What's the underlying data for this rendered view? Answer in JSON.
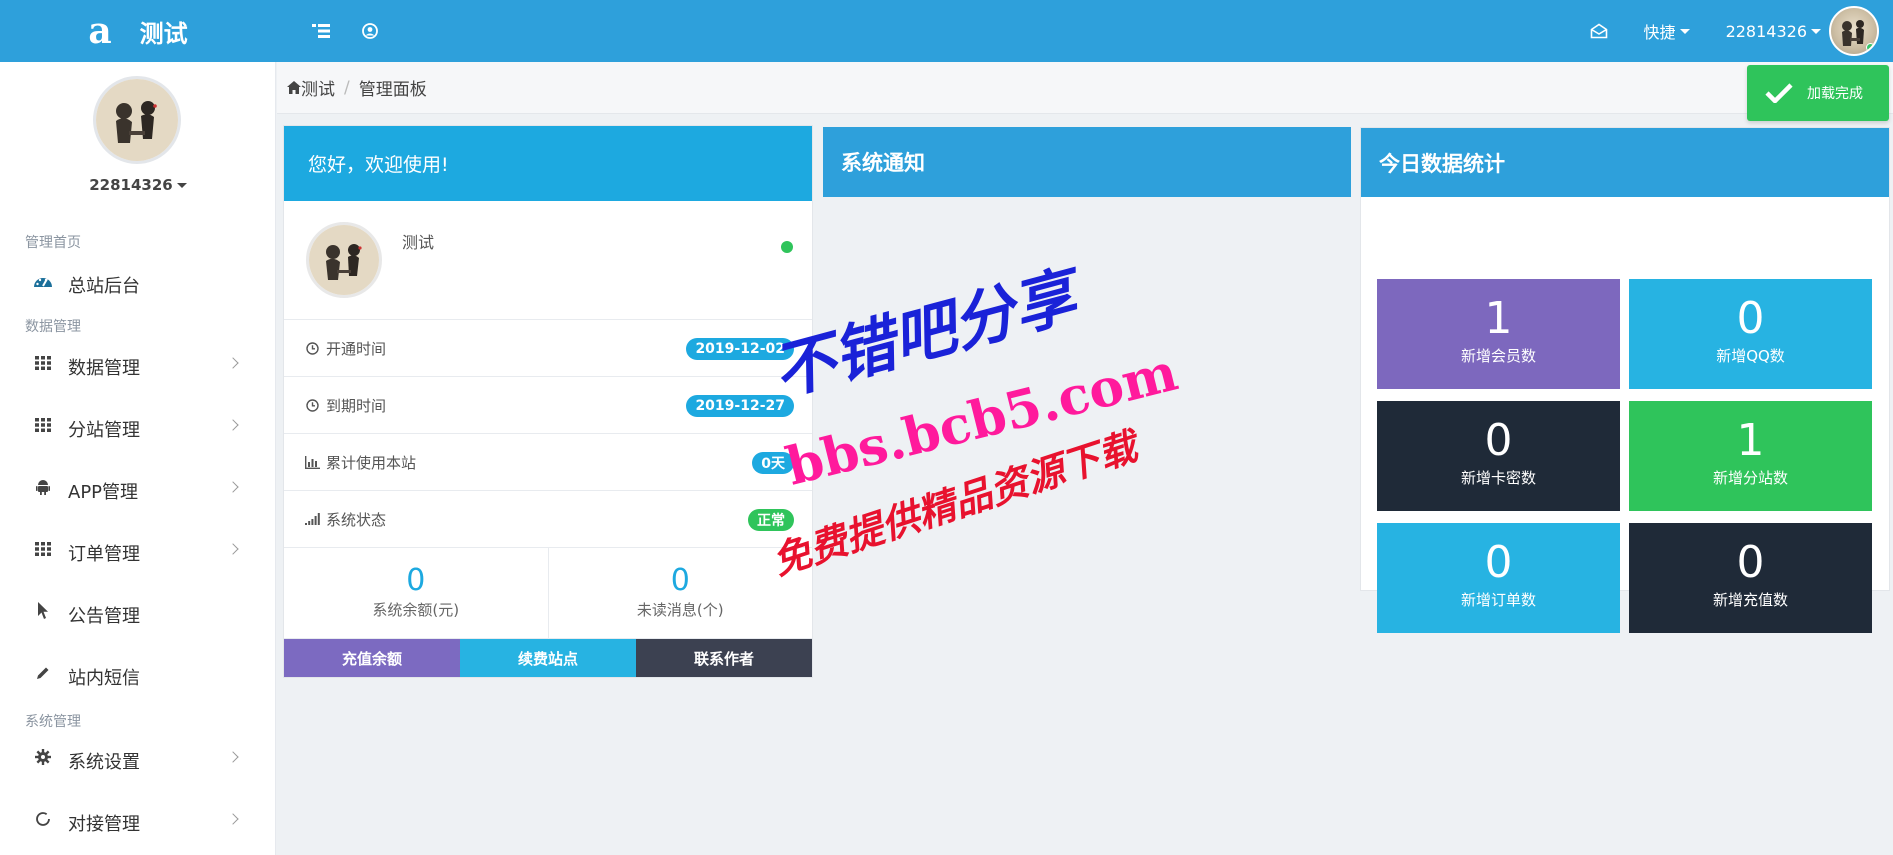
{
  "brand": {
    "logo": "a",
    "title": "测试"
  },
  "topbar": {
    "quick": "快捷",
    "username": "22814326"
  },
  "sidebar": {
    "username": "22814326",
    "sections": [
      "管理首页",
      "数据管理",
      "系统管理"
    ],
    "items": [
      {
        "label": "总站后台",
        "icon": "dashboard-icon"
      },
      {
        "label": "数据管理",
        "icon": "grid-icon"
      },
      {
        "label": "分站管理",
        "icon": "grid-icon"
      },
      {
        "label": "APP管理",
        "icon": "android-icon"
      },
      {
        "label": "订单管理",
        "icon": "grid-icon"
      },
      {
        "label": "公告管理",
        "icon": "pointer-icon"
      },
      {
        "label": "站内短信",
        "icon": "pencil-icon"
      },
      {
        "label": "系统设置",
        "icon": "gear-icon"
      },
      {
        "label": "对接管理",
        "icon": "circle-notch-icon"
      }
    ]
  },
  "breadcrumb": {
    "home": "测试",
    "current": "管理面板"
  },
  "toast": {
    "message": "加载完成"
  },
  "welcome": {
    "title": "您好，欢迎使用!",
    "site_name": "测试",
    "rows": [
      {
        "label": "开通时间",
        "badge": "2019-12-02",
        "badge_color": "#1da9e0"
      },
      {
        "label": "到期时间",
        "badge": "2019-12-27",
        "badge_color": "#1da9e0"
      },
      {
        "label": "累计使用本站",
        "badge": "0天",
        "badge_color": "#1da9e0"
      },
      {
        "label": "系统状态",
        "badge": "正常",
        "badge_color": "#2fc45b"
      }
    ],
    "balance_value": "0",
    "balance_label": "系统余额(元)",
    "messages_value": "0",
    "messages_label": "未读消息(个)",
    "buttons": [
      {
        "label": "充值余额",
        "color": "#7c6ac1"
      },
      {
        "label": "续费站点",
        "color": "#27b3e2"
      },
      {
        "label": "联系作者",
        "color": "#3c4151"
      }
    ]
  },
  "notice": {
    "title": "系统通知"
  },
  "today": {
    "title": "今日数据统计",
    "tiles": [
      {
        "value": "1",
        "label": "新增会员数",
        "color": "#7d68be"
      },
      {
        "value": "0",
        "label": "新增QQ数",
        "color": "#27b3e2"
      },
      {
        "value": "0",
        "label": "新增卡密数",
        "color": "#1f2a38"
      },
      {
        "value": "1",
        "label": "新增分站数",
        "color": "#2fc45b"
      },
      {
        "value": "0",
        "label": "新增订单数",
        "color": "#27b3e2"
      },
      {
        "value": "0",
        "label": "新增充值数",
        "color": "#1f2a38"
      }
    ]
  },
  "watermark": {
    "line1": "不错吧分享",
    "line2": "bbs.bcb5.com",
    "line3": "免费提供精品资源下载"
  }
}
